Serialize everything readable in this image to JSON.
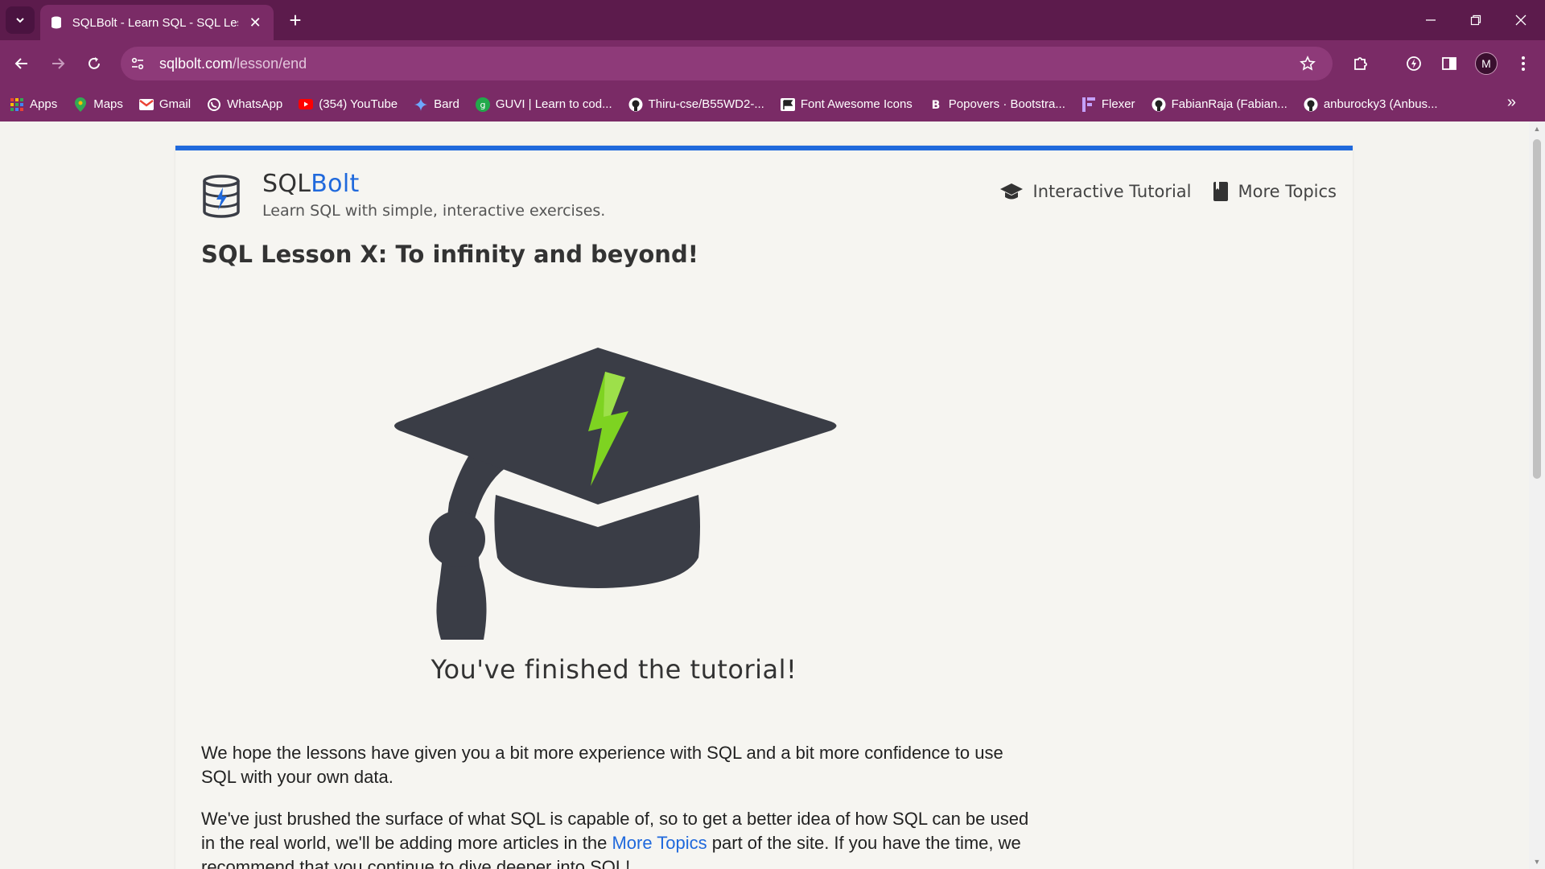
{
  "browser": {
    "tab_title": "SQLBolt - Learn SQL - SQL Less",
    "url_host": "sqlbolt.com",
    "url_path": "/lesson/end",
    "avatar_letter": "M",
    "bookmarks": [
      {
        "label": "Apps",
        "icon": "apps-grid-icon"
      },
      {
        "label": "Maps",
        "icon": "maps-pin-icon"
      },
      {
        "label": "Gmail",
        "icon": "gmail-icon"
      },
      {
        "label": "WhatsApp",
        "icon": "whatsapp-icon"
      },
      {
        "label": "(354) YouTube",
        "icon": "youtube-icon"
      },
      {
        "label": "Bard",
        "icon": "bard-sparkle-icon"
      },
      {
        "label": "GUVI | Learn to cod...",
        "icon": "guvi-icon"
      },
      {
        "label": "Thiru-cse/B55WD2-...",
        "icon": "github-icon"
      },
      {
        "label": "Font Awesome Icons",
        "icon": "flag-icon"
      },
      {
        "label": "Popovers · Bootstra...",
        "icon": "bootstrap-icon"
      },
      {
        "label": "Flexer",
        "icon": "flexer-icon"
      },
      {
        "label": "FabianRaja (Fabian...",
        "icon": "github-icon"
      },
      {
        "label": "anburocky3 (Anbus...",
        "icon": "github-icon"
      }
    ]
  },
  "page": {
    "brand_prefix": "SQL",
    "brand_suffix": "Bolt",
    "tagline": "Learn SQL with simple, interactive exercises.",
    "nav": {
      "tutorial": "Interactive Tutorial",
      "topics": "More Topics"
    },
    "lesson_title": "SQL Lesson X: To infinity and beyond!",
    "finished": "You've finished the tutorial!",
    "para1": "We hope the lessons have given you a bit more experience with SQL and a bit more confidence to use SQL with your own data.",
    "para2_before": "We've just brushed the surface of what SQL is capable of, so to get a better idea of how SQL can be used in the real world, we'll be adding more articles in the ",
    "para2_link": "More Topics",
    "para2_after": " part of the site. If you have the time, we recommend that you continue to dive deeper into SQL!",
    "colors": {
      "accent": "#2069dc",
      "bolt": "#7ed321",
      "chrome": "#5c1b4c"
    }
  }
}
